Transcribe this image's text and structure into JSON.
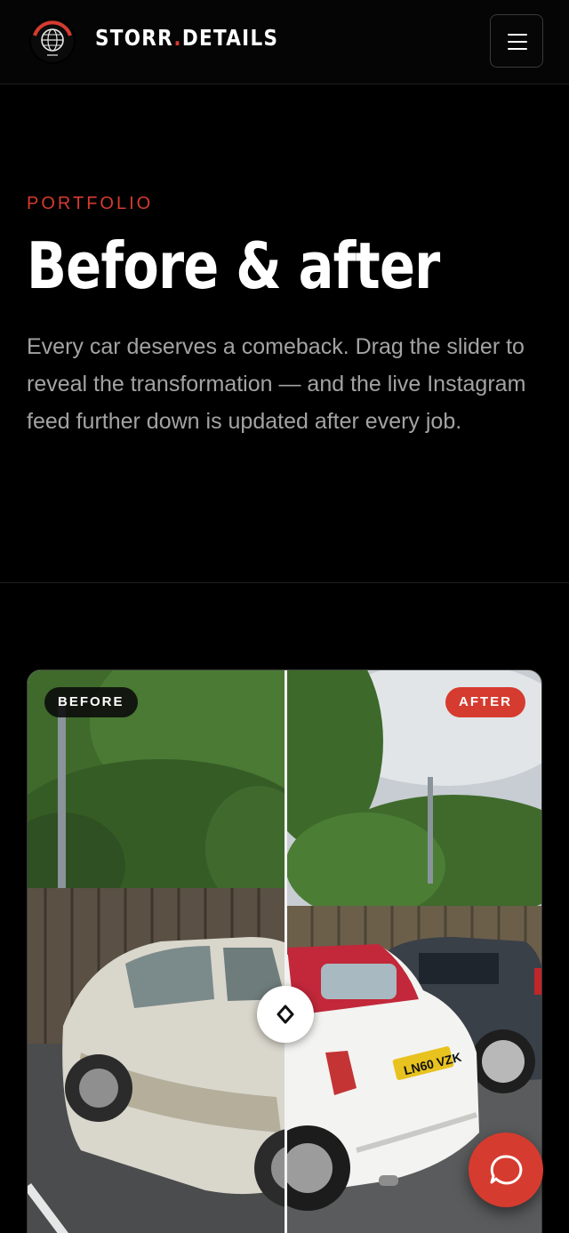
{
  "header": {
    "brand_part1": "STORR",
    "brand_dot": ".",
    "brand_part2": "DETAILS",
    "logo_icon": "globe-emblem-logo",
    "menu_icon": "hamburger-menu-icon"
  },
  "hero": {
    "eyebrow": "PORTFOLIO",
    "title": "Before & after",
    "lead": "Every car deserves a comeback. Drag the slider to reveal the transformation — and the live Instagram feed further down is updated after every job."
  },
  "compare": {
    "before_label": "BEFORE",
    "after_label": "AFTER",
    "slider_position_percent": 50,
    "plate_text": "LN60 VZK"
  },
  "chat": {
    "icon": "chat-bubble-icon"
  },
  "colors": {
    "accent": "#d63b2f",
    "background": "#000000",
    "muted_text": "#a3a3a3"
  }
}
